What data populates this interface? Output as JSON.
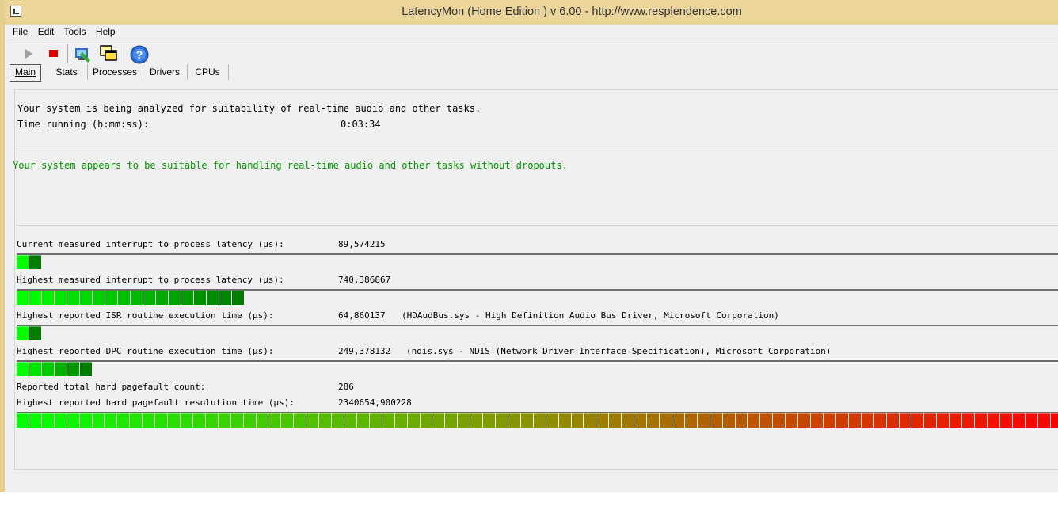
{
  "window": {
    "title": "LatencyMon  (Home Edition )  v 6.00 - http://www.resplendence.com"
  },
  "menu": {
    "items": [
      {
        "name": "menu-file",
        "accel": "F",
        "rest": "ile"
      },
      {
        "name": "menu-edit",
        "accel": "E",
        "rest": "dit"
      },
      {
        "name": "menu-tools",
        "accel": "T",
        "rest": "ools"
      },
      {
        "name": "menu-help",
        "accel": "H",
        "rest": "elp"
      }
    ]
  },
  "toolbar": {
    "buttons": [
      {
        "name": "start-icon"
      },
      {
        "name": "stop-icon"
      },
      {
        "name": "analyze-icon"
      },
      {
        "name": "windows-icon"
      },
      {
        "name": "help-icon"
      }
    ]
  },
  "tabs": [
    {
      "label": "Main",
      "active": true
    },
    {
      "label": "Stats",
      "active": false
    },
    {
      "label": "Processes",
      "active": false
    },
    {
      "label": "Drivers",
      "active": false
    },
    {
      "label": "CPUs",
      "active": false
    }
  ],
  "status": {
    "analyzing_text": "Your system is being analyzed for suitability of real-time audio and other tasks.",
    "time_label": "Time running (h:mm:ss):",
    "time_value": "0:03:34",
    "verdict": "Your system appears to be suitable for handling real-time audio and other tasks without dropouts.",
    "verdict_color": "#009a00"
  },
  "metrics": {
    "current_latency": {
      "label": "Current measured interrupt to process latency (µs):",
      "value": "89,574215",
      "detail": "",
      "level_cells": 2
    },
    "highest_latency": {
      "label": "Highest measured interrupt to process latency (µs):",
      "value": "740,386867",
      "detail": "",
      "level_cells": 18
    },
    "highest_isr": {
      "label": "Highest reported ISR routine execution time (µs):",
      "value": "64,860137",
      "detail": "(HDAudBus.sys - High Definition Audio Bus Driver, Microsoft Corporation)",
      "level_cells": 2
    },
    "highest_dpc": {
      "label": "Highest reported DPC routine execution time (µs):",
      "value": "249,378132",
      "detail": "(ndis.sys - NDIS (Network Driver Interface Specification), Microsoft Corporation)",
      "level_cells": 6
    },
    "pagefault_count": {
      "label": "Reported total hard pagefault count:",
      "value": "286"
    },
    "pagefault_time": {
      "label": "Highest reported hard pagefault resolution time (µs):",
      "value": "2340654,900228",
      "detail": "",
      "level_cells": 83
    }
  },
  "colors": {
    "bar_start": "#00ff00",
    "bar_end": "#ff0000"
  }
}
